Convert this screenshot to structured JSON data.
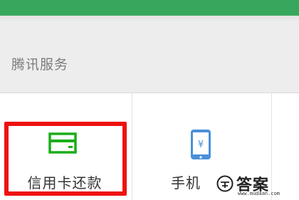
{
  "header": {
    "bar_color": "#37a75d"
  },
  "section": {
    "title": "腾讯服务"
  },
  "services": [
    {
      "label": "信用卡还款",
      "icon": "credit-card-icon",
      "icon_color": "#1aad19"
    },
    {
      "label": "手机",
      "icon": "phone-icon",
      "icon_color": "#4a90d9"
    }
  ],
  "highlight": {
    "color": "#ee1111",
    "target": "信用卡还款"
  },
  "watermark": {
    "text": "答案",
    "url": "www.mudaan.com"
  }
}
